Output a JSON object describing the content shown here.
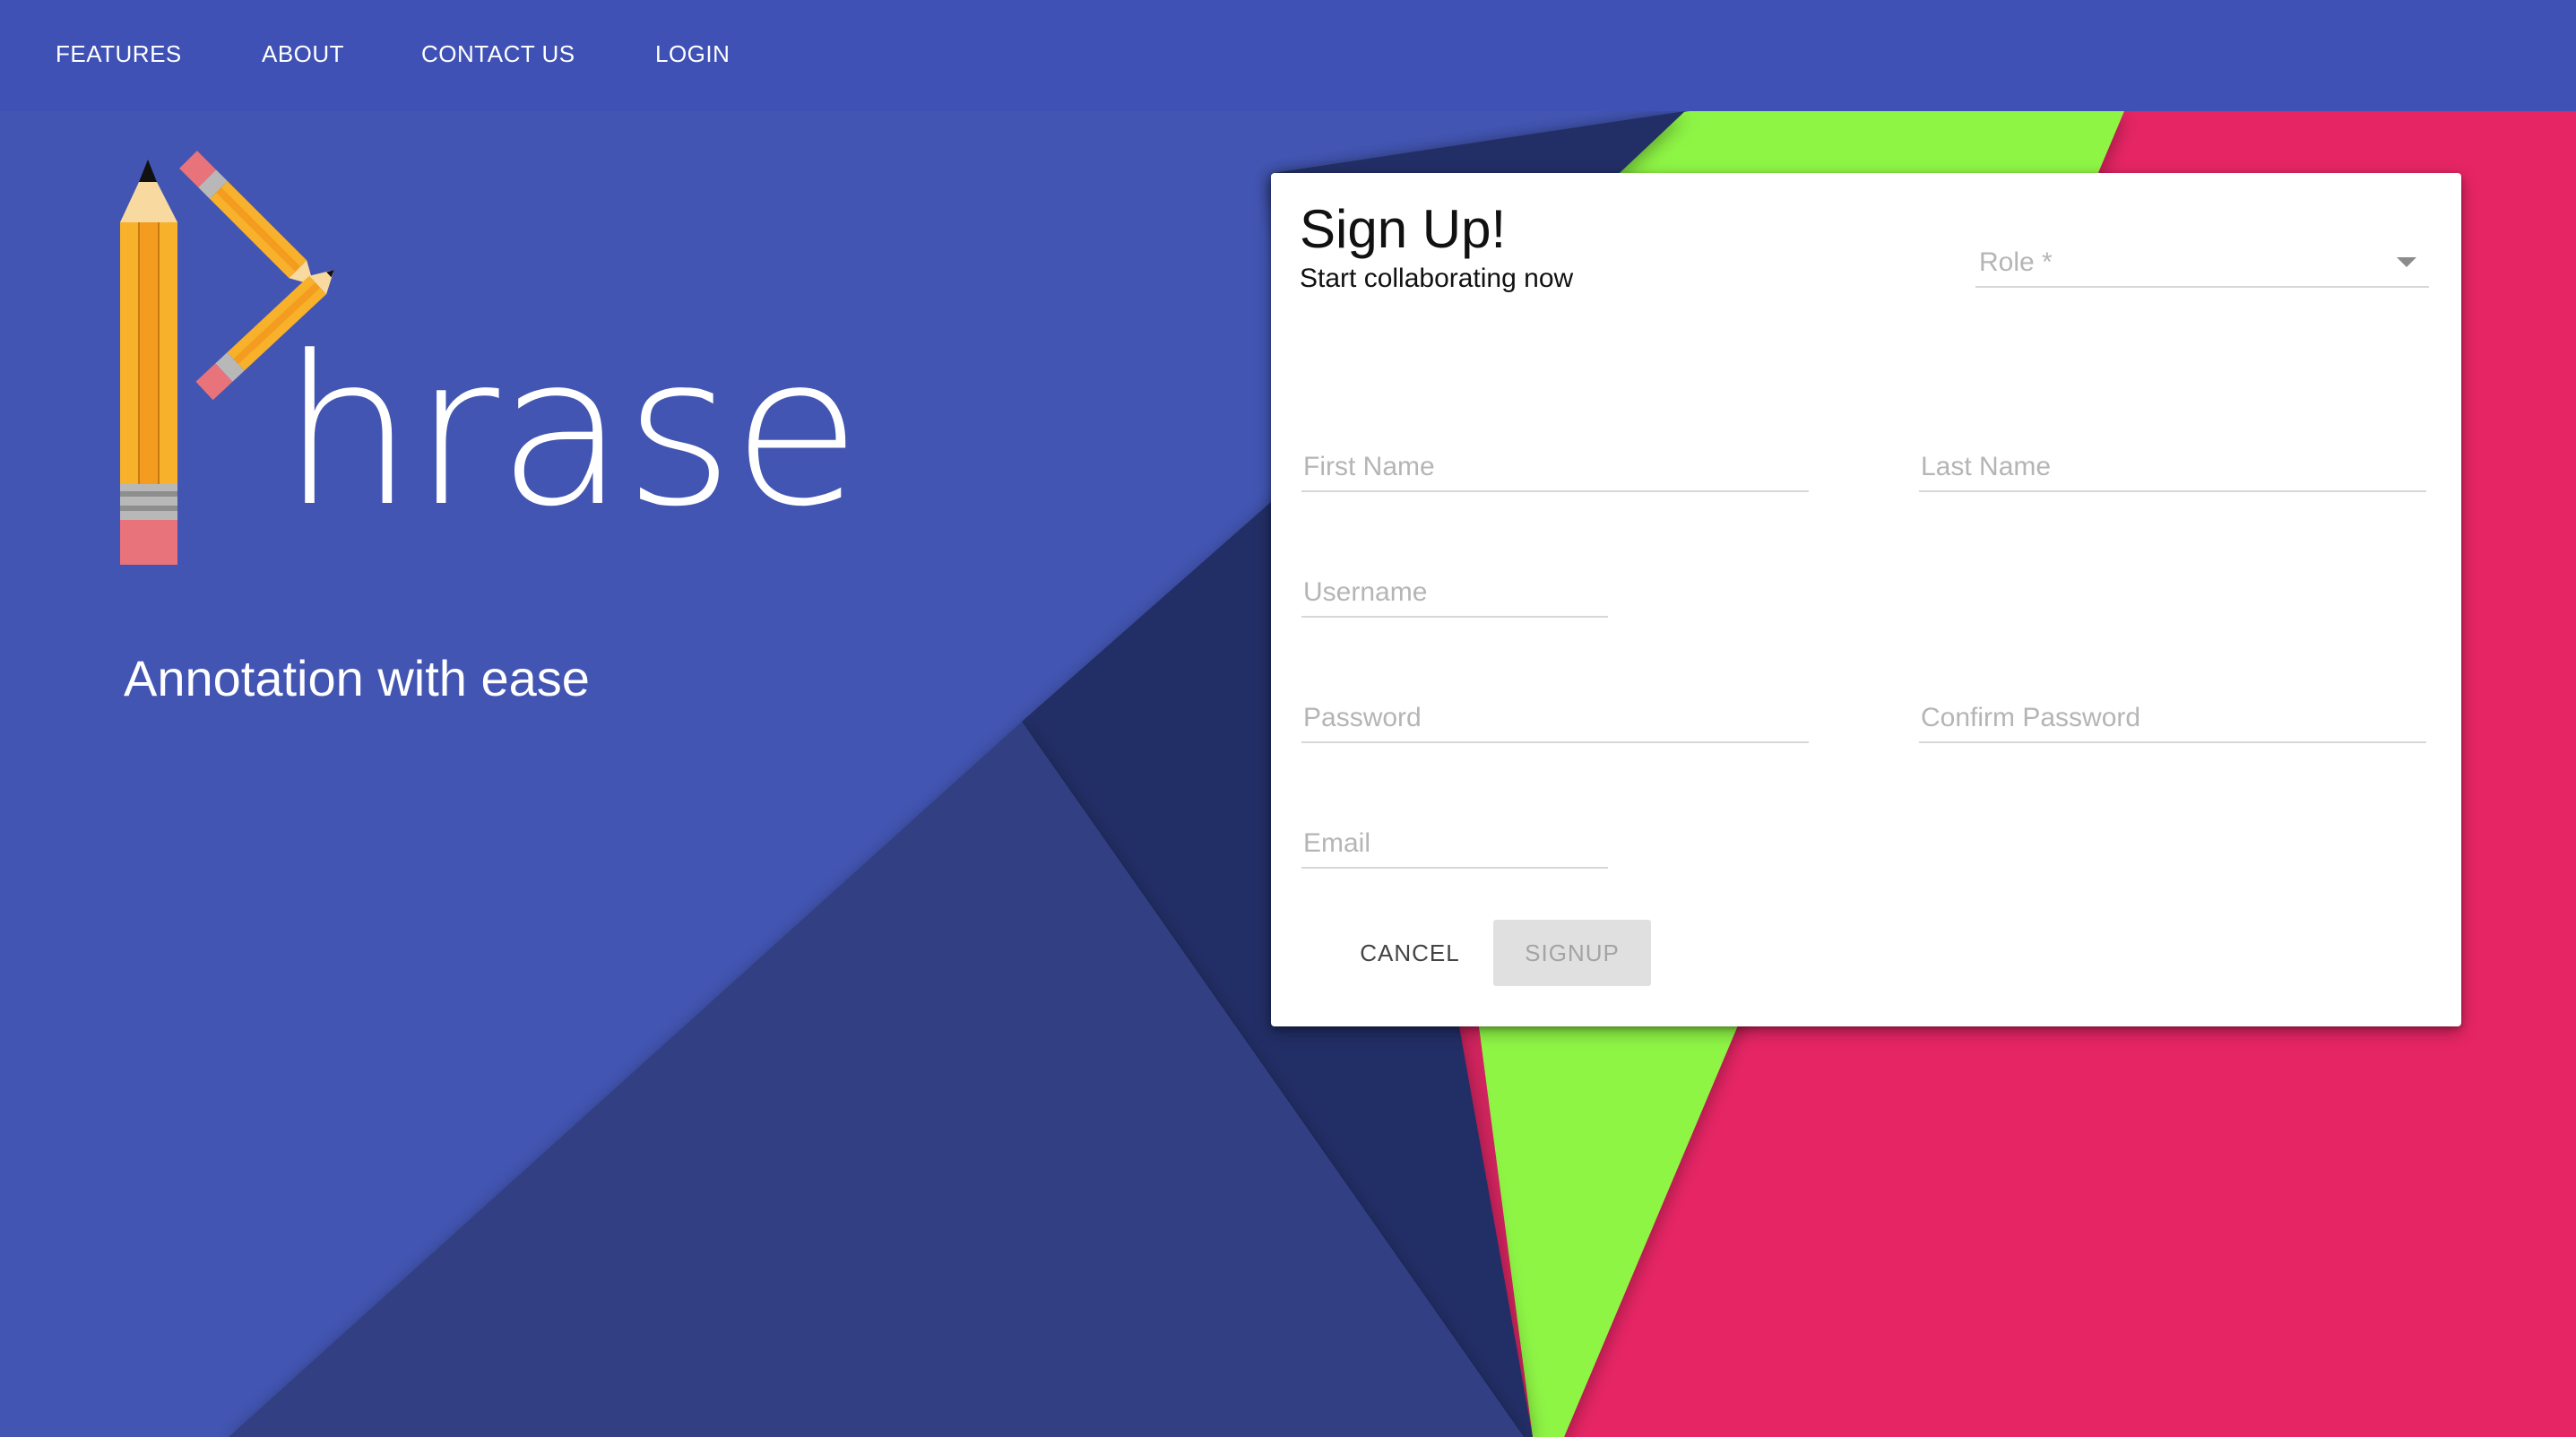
{
  "nav": {
    "features": "FEATURES",
    "about": "ABOUT",
    "contact": "CONTACT US",
    "login": "LOGIN"
  },
  "hero": {
    "logo_text": "hrase",
    "tagline": "Annotation with ease"
  },
  "signup": {
    "title": "Sign Up!",
    "subtitle": "Start collaborating now",
    "role_label": "Role *",
    "first_name_placeholder": "First Name",
    "last_name_placeholder": "Last Name",
    "username_placeholder": "Username",
    "password_placeholder": "Password",
    "confirm_password_placeholder": "Confirm Password",
    "email_placeholder": "Email",
    "cancel_label": "CANCEL",
    "signup_label": "SIGNUP"
  },
  "colors": {
    "primary": "#3f51b5",
    "accent_green": "#8ef545",
    "accent_pink": "#e62565",
    "dark_indigo": "#232e66",
    "mid_indigo": "#334083"
  }
}
